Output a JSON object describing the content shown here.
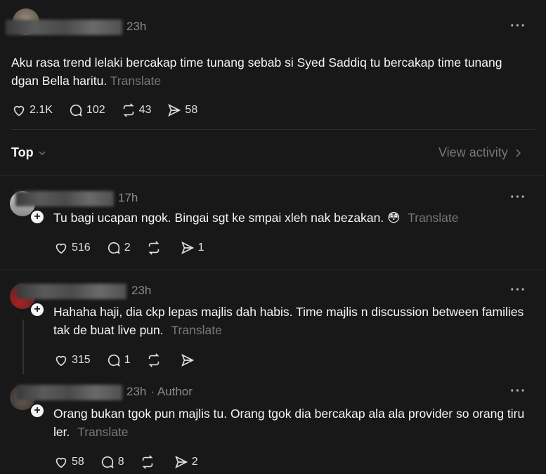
{
  "post": {
    "time": "23h",
    "text": "Aku rasa trend lelaki bercakap time tunang sebab si Syed Saddiq tu bercakap time tunang dgan Bella haritu.",
    "translate": "Translate",
    "likes": "2.1K",
    "replies": "102",
    "reposts": "43",
    "shares": "58"
  },
  "sort": {
    "label": "Top",
    "view_activity": "View activity"
  },
  "comments": [
    {
      "time": "17h",
      "text": "Tu bagi ucapan ngok. Bingai sgt ke smpai xleh nak bezakan.",
      "emoji": "😳",
      "translate": "Translate",
      "likes": "516",
      "replies": "2",
      "shares": "1"
    },
    {
      "time": "23h",
      "text": "Hahaha haji, dia ckp lepas majlis dah habis. Time majlis n discussion between families tak de buat live pun.",
      "translate": "Translate",
      "likes": "315",
      "replies": "1",
      "shares": ""
    },
    {
      "time": "23h",
      "author_tag": "· Author",
      "text": "Orang bukan tgok pun majlis tu. Orang tgok dia bercakap ala ala provider so orang tiru ler.",
      "translate": "Translate",
      "likes": "58",
      "replies": "8",
      "shares": "2"
    }
  ],
  "colors": {
    "background": "#181818",
    "text": "#f3f5f7",
    "muted": "#777777"
  }
}
